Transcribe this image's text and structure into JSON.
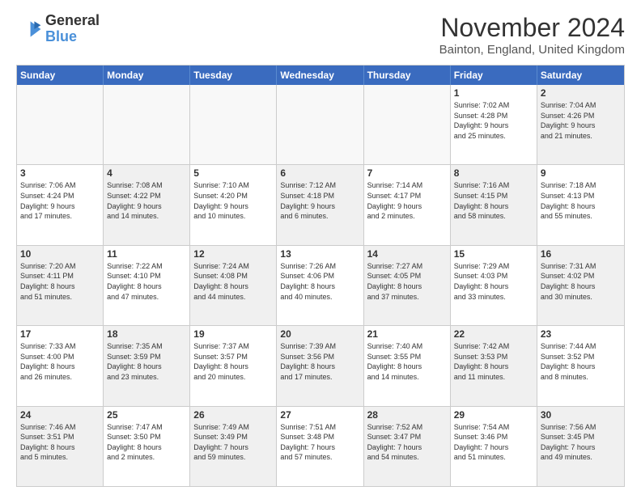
{
  "header": {
    "logo_line1": "General",
    "logo_line2": "Blue",
    "month_title": "November 2024",
    "location": "Bainton, England, United Kingdom"
  },
  "days_of_week": [
    "Sunday",
    "Monday",
    "Tuesday",
    "Wednesday",
    "Thursday",
    "Friday",
    "Saturday"
  ],
  "weeks": [
    [
      {
        "day": "",
        "info": "",
        "empty": true
      },
      {
        "day": "",
        "info": "",
        "empty": true
      },
      {
        "day": "",
        "info": "",
        "empty": true
      },
      {
        "day": "",
        "info": "",
        "empty": true
      },
      {
        "day": "",
        "info": "",
        "empty": true
      },
      {
        "day": "1",
        "info": "Sunrise: 7:02 AM\nSunset: 4:28 PM\nDaylight: 9 hours\nand 25 minutes.",
        "empty": false,
        "shaded": false
      },
      {
        "day": "2",
        "info": "Sunrise: 7:04 AM\nSunset: 4:26 PM\nDaylight: 9 hours\nand 21 minutes.",
        "empty": false,
        "shaded": true
      }
    ],
    [
      {
        "day": "3",
        "info": "Sunrise: 7:06 AM\nSunset: 4:24 PM\nDaylight: 9 hours\nand 17 minutes.",
        "empty": false,
        "shaded": false
      },
      {
        "day": "4",
        "info": "Sunrise: 7:08 AM\nSunset: 4:22 PM\nDaylight: 9 hours\nand 14 minutes.",
        "empty": false,
        "shaded": true
      },
      {
        "day": "5",
        "info": "Sunrise: 7:10 AM\nSunset: 4:20 PM\nDaylight: 9 hours\nand 10 minutes.",
        "empty": false,
        "shaded": false
      },
      {
        "day": "6",
        "info": "Sunrise: 7:12 AM\nSunset: 4:18 PM\nDaylight: 9 hours\nand 6 minutes.",
        "empty": false,
        "shaded": true
      },
      {
        "day": "7",
        "info": "Sunrise: 7:14 AM\nSunset: 4:17 PM\nDaylight: 9 hours\nand 2 minutes.",
        "empty": false,
        "shaded": false
      },
      {
        "day": "8",
        "info": "Sunrise: 7:16 AM\nSunset: 4:15 PM\nDaylight: 8 hours\nand 58 minutes.",
        "empty": false,
        "shaded": true
      },
      {
        "day": "9",
        "info": "Sunrise: 7:18 AM\nSunset: 4:13 PM\nDaylight: 8 hours\nand 55 minutes.",
        "empty": false,
        "shaded": false
      }
    ],
    [
      {
        "day": "10",
        "info": "Sunrise: 7:20 AM\nSunset: 4:11 PM\nDaylight: 8 hours\nand 51 minutes.",
        "empty": false,
        "shaded": true
      },
      {
        "day": "11",
        "info": "Sunrise: 7:22 AM\nSunset: 4:10 PM\nDaylight: 8 hours\nand 47 minutes.",
        "empty": false,
        "shaded": false
      },
      {
        "day": "12",
        "info": "Sunrise: 7:24 AM\nSunset: 4:08 PM\nDaylight: 8 hours\nand 44 minutes.",
        "empty": false,
        "shaded": true
      },
      {
        "day": "13",
        "info": "Sunrise: 7:26 AM\nSunset: 4:06 PM\nDaylight: 8 hours\nand 40 minutes.",
        "empty": false,
        "shaded": false
      },
      {
        "day": "14",
        "info": "Sunrise: 7:27 AM\nSunset: 4:05 PM\nDaylight: 8 hours\nand 37 minutes.",
        "empty": false,
        "shaded": true
      },
      {
        "day": "15",
        "info": "Sunrise: 7:29 AM\nSunset: 4:03 PM\nDaylight: 8 hours\nand 33 minutes.",
        "empty": false,
        "shaded": false
      },
      {
        "day": "16",
        "info": "Sunrise: 7:31 AM\nSunset: 4:02 PM\nDaylight: 8 hours\nand 30 minutes.",
        "empty": false,
        "shaded": true
      }
    ],
    [
      {
        "day": "17",
        "info": "Sunrise: 7:33 AM\nSunset: 4:00 PM\nDaylight: 8 hours\nand 26 minutes.",
        "empty": false,
        "shaded": false
      },
      {
        "day": "18",
        "info": "Sunrise: 7:35 AM\nSunset: 3:59 PM\nDaylight: 8 hours\nand 23 minutes.",
        "empty": false,
        "shaded": true
      },
      {
        "day": "19",
        "info": "Sunrise: 7:37 AM\nSunset: 3:57 PM\nDaylight: 8 hours\nand 20 minutes.",
        "empty": false,
        "shaded": false
      },
      {
        "day": "20",
        "info": "Sunrise: 7:39 AM\nSunset: 3:56 PM\nDaylight: 8 hours\nand 17 minutes.",
        "empty": false,
        "shaded": true
      },
      {
        "day": "21",
        "info": "Sunrise: 7:40 AM\nSunset: 3:55 PM\nDaylight: 8 hours\nand 14 minutes.",
        "empty": false,
        "shaded": false
      },
      {
        "day": "22",
        "info": "Sunrise: 7:42 AM\nSunset: 3:53 PM\nDaylight: 8 hours\nand 11 minutes.",
        "empty": false,
        "shaded": true
      },
      {
        "day": "23",
        "info": "Sunrise: 7:44 AM\nSunset: 3:52 PM\nDaylight: 8 hours\nand 8 minutes.",
        "empty": false,
        "shaded": false
      }
    ],
    [
      {
        "day": "24",
        "info": "Sunrise: 7:46 AM\nSunset: 3:51 PM\nDaylight: 8 hours\nand 5 minutes.",
        "empty": false,
        "shaded": true
      },
      {
        "day": "25",
        "info": "Sunrise: 7:47 AM\nSunset: 3:50 PM\nDaylight: 8 hours\nand 2 minutes.",
        "empty": false,
        "shaded": false
      },
      {
        "day": "26",
        "info": "Sunrise: 7:49 AM\nSunset: 3:49 PM\nDaylight: 7 hours\nand 59 minutes.",
        "empty": false,
        "shaded": true
      },
      {
        "day": "27",
        "info": "Sunrise: 7:51 AM\nSunset: 3:48 PM\nDaylight: 7 hours\nand 57 minutes.",
        "empty": false,
        "shaded": false
      },
      {
        "day": "28",
        "info": "Sunrise: 7:52 AM\nSunset: 3:47 PM\nDaylight: 7 hours\nand 54 minutes.",
        "empty": false,
        "shaded": true
      },
      {
        "day": "29",
        "info": "Sunrise: 7:54 AM\nSunset: 3:46 PM\nDaylight: 7 hours\nand 51 minutes.",
        "empty": false,
        "shaded": false
      },
      {
        "day": "30",
        "info": "Sunrise: 7:56 AM\nSunset: 3:45 PM\nDaylight: 7 hours\nand 49 minutes.",
        "empty": false,
        "shaded": true
      }
    ]
  ]
}
